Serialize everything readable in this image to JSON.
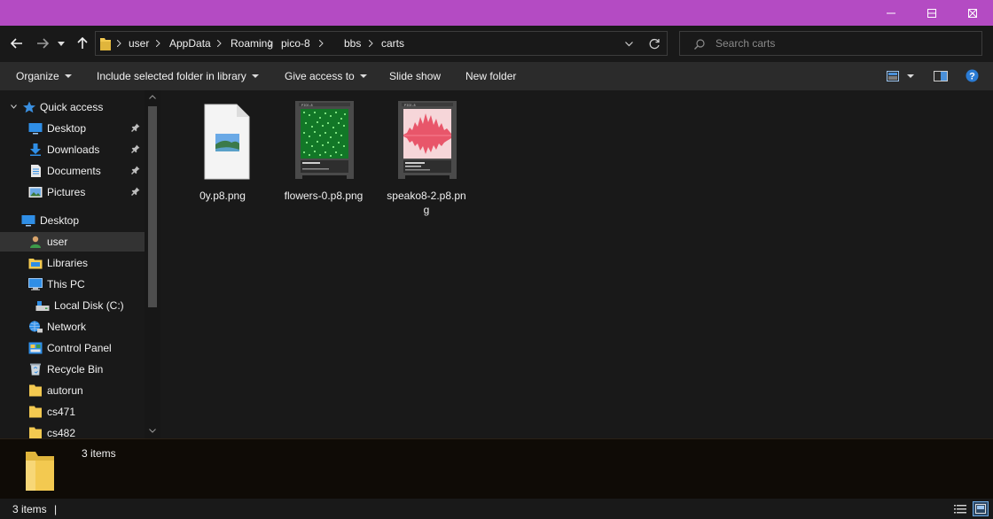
{
  "window": {
    "titlebar_color": "#b44bc3",
    "controls": [
      "minimize-icon",
      "maximize-icon",
      "close-icon"
    ]
  },
  "address": {
    "crumbs": [
      "user",
      "AppData",
      "Roaming",
      "pico-8",
      "bbs",
      "carts"
    ]
  },
  "search": {
    "placeholder": "Search carts"
  },
  "toolbar": {
    "organize": "Organize",
    "include_library": "Include selected folder in library",
    "give_access": "Give access to",
    "slide_show": "Slide show",
    "new_folder": "New folder"
  },
  "nav": {
    "quick_access": "Quick access",
    "desktop_qa": "Desktop",
    "downloads": "Downloads",
    "documents": "Documents",
    "pictures": "Pictures",
    "desktop": "Desktop",
    "user": "user",
    "libraries": "Libraries",
    "this_pc": "This PC",
    "local_disk": "Local Disk (C:)",
    "network": "Network",
    "control_panel": "Control Panel",
    "recycle_bin": "Recycle Bin",
    "autorun": "autorun",
    "cs471": "cs471",
    "cs482": "cs482"
  },
  "files": [
    {
      "name": "0y.p8.png",
      "thumb": "image-file-icon"
    },
    {
      "name": "flowers-0.p8.png",
      "thumb": "pico8-cart-green"
    },
    {
      "name": "speako8-2.p8.png",
      "thumb": "pico8-cart-pink"
    }
  ],
  "details": {
    "count": "3 items"
  },
  "status": {
    "count": "3 items",
    "cursor": "|"
  },
  "colors": {
    "accent": "#b44bc3",
    "background": "#191919",
    "toolbar": "#2b2b2b",
    "folder": "#f3c950",
    "cart_green": "#1a9a33",
    "cart_pink": "#e8566a"
  }
}
